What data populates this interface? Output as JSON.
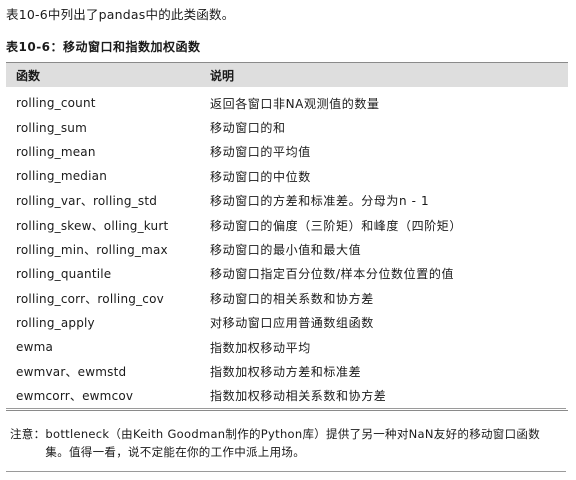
{
  "intro": "表10-6中列出了pandas中的此类函数。",
  "caption": "表10-6：移动窗口和指数加权函数",
  "table": {
    "headers": [
      "函数",
      "说明"
    ],
    "rows": [
      {
        "fn": "rolling_count",
        "desc": "返回各窗口非NA观测值的数量"
      },
      {
        "fn": "rolling_sum",
        "desc": "移动窗口的和"
      },
      {
        "fn": "rolling_mean",
        "desc": "移动窗口的平均值"
      },
      {
        "fn": "rolling_median",
        "desc": "移动窗口的中位数"
      },
      {
        "fn": "rolling_var、rolling_std",
        "desc": "移动窗口的方差和标准差。分母为n - 1"
      },
      {
        "fn": "rolling_skew、olling_kurt",
        "desc": "移动窗口的偏度（三阶矩）和峰度（四阶矩）"
      },
      {
        "fn": "rolling_min、rolling_max",
        "desc": "移动窗口的最小值和最大值"
      },
      {
        "fn": "rolling_quantile",
        "desc": "移动窗口指定百分位数/样本分位数位置的值"
      },
      {
        "fn": "rolling_corr、rolling_cov",
        "desc": "移动窗口的相关系数和协方差"
      },
      {
        "fn": "rolling_apply",
        "desc": "对移动窗口应用普通数组函数"
      },
      {
        "fn": "ewma",
        "desc": "指数加权移动平均"
      },
      {
        "fn": "ewmvar、ewmstd",
        "desc": "指数加权移动方差和标准差"
      },
      {
        "fn": "ewmcorr、ewmcov",
        "desc": "指数加权移动相关系数和协方差"
      }
    ]
  },
  "note": {
    "label": "注意：",
    "text": "bottleneck（由Keith Goodman制作的Python库）提供了另一种对NaN友好的移动窗口函数集。值得一看，说不定能在你的工作中派上用场。"
  }
}
